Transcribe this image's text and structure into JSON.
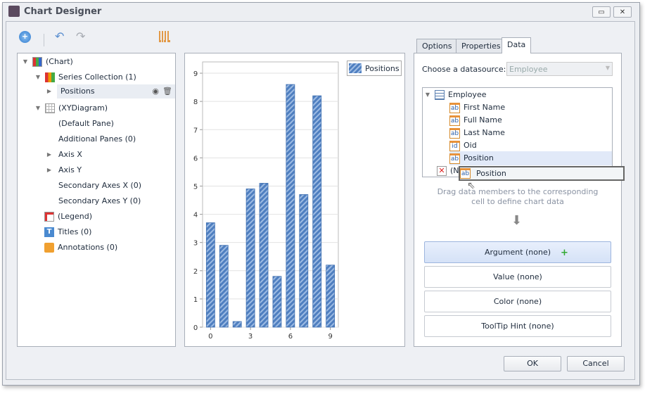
{
  "window": {
    "title": "Chart Designer",
    "minimize": "▭",
    "close": "✕"
  },
  "toolbar": {
    "add": "add-icon",
    "undo": "undo-icon",
    "redo": "redo-icon",
    "chart_wizard": "chart-type-icon"
  },
  "tree": {
    "chart": "(Chart)",
    "series_collection": "Series Collection (1)",
    "series": "Positions",
    "diagram": "(XYDiagram)",
    "default_pane": "(Default Pane)",
    "additional_panes": "Additional Panes (0)",
    "axis_x": "Axis X",
    "axis_y": "Axis Y",
    "secondary_x": "Secondary Axes X (0)",
    "secondary_y": "Secondary Axes Y (0)",
    "legend": "(Legend)",
    "titles": "Titles (0)",
    "annotations": "Annotations (0)"
  },
  "tabs": [
    {
      "label": "Options"
    },
    {
      "label": "Properties"
    },
    {
      "label": "Data",
      "active": true
    }
  ],
  "data_tab": {
    "datasource_label": "Choose a datasource:",
    "datasource_value": "Employee",
    "root": "Employee",
    "fields": [
      {
        "label": "First Name",
        "type": "ab"
      },
      {
        "label": "Full Name",
        "type": "ab"
      },
      {
        "label": "Last Name",
        "type": "ab"
      },
      {
        "label": "Oid",
        "type": "id"
      },
      {
        "label": "Position",
        "type": "ab"
      }
    ],
    "none_item": "(N",
    "drag_item": "Position",
    "hint": "Drag data members to the corresponding cell to define chart data",
    "cells": [
      "Argument (none)",
      "Value (none)",
      "Color (none)",
      "ToolTip Hint (none)"
    ]
  },
  "buttons": {
    "ok": "OK",
    "cancel": "Cancel"
  },
  "colors": {
    "bar": "#4f7fc0",
    "bar_stripe": "#9dbbe3",
    "selection": "#e1e9f8",
    "accent": "#dde7f9"
  },
  "chart_data": {
    "type": "bar",
    "x": [
      0,
      1,
      2,
      3,
      4,
      5,
      6,
      7,
      8,
      9
    ],
    "series": [
      {
        "name": "Positions",
        "values": [
          3.7,
          2.9,
          0.2,
          4.9,
          5.1,
          1.8,
          8.6,
          4.7,
          8.2,
          2.2
        ]
      }
    ],
    "xticks": [
      "0",
      "3",
      "6",
      "9"
    ],
    "yticks": [
      "0",
      "1",
      "2",
      "3",
      "4",
      "5",
      "6",
      "7",
      "8",
      "9"
    ],
    "ylim": [
      0,
      9.4
    ],
    "xlim": [
      -0.6,
      9.6
    ],
    "grid": true,
    "legend": "top-right"
  }
}
